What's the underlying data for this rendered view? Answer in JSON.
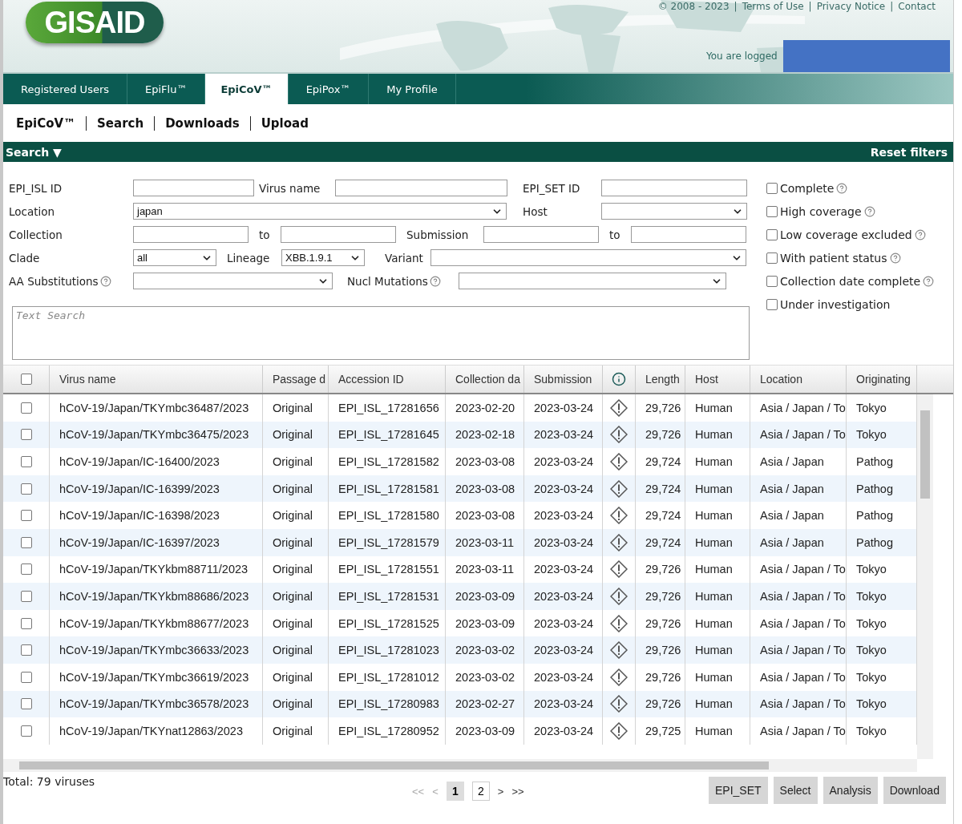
{
  "header": {
    "top_links": [
      "© 2008 - 2023",
      "|",
      "Terms of Use",
      "|",
      "Privacy Notice",
      "|",
      "Contact"
    ],
    "logo": "GISAID",
    "login_text": "You are logged"
  },
  "nav_tabs": [
    {
      "label": "Registered Users",
      "selected": false
    },
    {
      "label": "EpiFlu™",
      "selected": false
    },
    {
      "label": "EpiCoV™",
      "selected": true
    },
    {
      "label": "EpiPox™",
      "selected": false
    },
    {
      "label": "My Profile",
      "selected": false
    }
  ],
  "sub_nav": [
    "EpiCoV™",
    "Search",
    "Downloads",
    "Upload"
  ],
  "search_bar": {
    "title": "Search ▼",
    "reset": "Reset filters"
  },
  "filters": [
    [
      {
        "kind": "label",
        "text": "EPI_ISL ID"
      },
      {
        "kind": "input"
      },
      {
        "kind": "label",
        "text": "Virus name"
      },
      {
        "kind": "input"
      },
      {
        "kind": "label",
        "text": "EPI_SET ID"
      },
      {
        "kind": "input"
      }
    ],
    [
      {
        "kind": "label",
        "text": "Location"
      },
      {
        "kind": "select",
        "value": "japan"
      },
      {
        "kind": "label",
        "text": "Host"
      },
      {
        "kind": "select"
      }
    ],
    [
      {
        "kind": "label",
        "text": "Collection"
      },
      {
        "kind": "input"
      },
      {
        "kind": "label",
        "text": "to"
      },
      {
        "kind": "input"
      },
      {
        "kind": "label",
        "text": "Submission"
      },
      {
        "kind": "input"
      },
      {
        "kind": "label",
        "text": "to"
      },
      {
        "kind": "input"
      }
    ],
    [
      {
        "kind": "label",
        "text": "Clade"
      },
      {
        "kind": "select",
        "value": "all"
      },
      {
        "kind": "label",
        "text": "Lineage"
      },
      {
        "kind": "select",
        "value": "XBB.1.9.1"
      },
      {
        "kind": "label",
        "text": "Variant"
      },
      {
        "kind": "select"
      }
    ],
    [
      {
        "kind": "label",
        "text": "AA Substitutions",
        "help": true
      },
      {
        "kind": "select"
      },
      {
        "kind": "label",
        "text": "Nucl Mutations",
        "help": true
      },
      {
        "kind": "select"
      }
    ]
  ],
  "options": [
    {
      "label": "Complete",
      "checked": false,
      "help": true
    },
    {
      "label": "High coverage",
      "checked": false,
      "help": true
    },
    {
      "label": "Low coverage excluded",
      "checked": false,
      "help": true
    },
    {
      "label": "With patient status",
      "checked": false,
      "help": true
    },
    {
      "label": "Collection date complete",
      "checked": false,
      "help": true
    },
    {
      "label": "Under investigation",
      "checked": false,
      "help": false
    }
  ],
  "text_search": {
    "placeholder": "Text Search"
  },
  "table": {
    "header_checked": false,
    "columns": [
      {
        "kind": "text",
        "label": "Virus name"
      },
      {
        "kind": "text",
        "label": "Passage d"
      },
      {
        "kind": "text",
        "label": "Accession ID"
      },
      {
        "kind": "text",
        "label": "Collection da"
      },
      {
        "kind": "text",
        "label": "Submission"
      },
      {
        "kind": "info"
      },
      {
        "kind": "text",
        "label": "Length"
      },
      {
        "kind": "text",
        "label": "Host"
      },
      {
        "kind": "text",
        "label": "Location"
      },
      {
        "kind": "text",
        "label": "Originating"
      }
    ],
    "rows": [
      {
        "checked": false,
        "cells": [
          "hCoV-19/Japan/TKYmbc36487/2023",
          "Original",
          "EPI_ISL_17281656",
          "2023-02-20",
          "2023-03-24",
          "",
          "29,726",
          "Human",
          "Asia / Japan / To",
          "Tokyo"
        ]
      },
      {
        "checked": false,
        "cells": [
          "hCoV-19/Japan/TKYmbc36475/2023",
          "Original",
          "EPI_ISL_17281645",
          "2023-02-18",
          "2023-03-24",
          "",
          "29,726",
          "Human",
          "Asia / Japan / To",
          "Tokyo"
        ]
      },
      {
        "checked": false,
        "cells": [
          "hCoV-19/Japan/IC-16400/2023",
          "Original",
          "EPI_ISL_17281582",
          "2023-03-08",
          "2023-03-24",
          "",
          "29,724",
          "Human",
          "Asia / Japan",
          "Pathog"
        ]
      },
      {
        "checked": false,
        "cells": [
          "hCoV-19/Japan/IC-16399/2023",
          "Original",
          "EPI_ISL_17281581",
          "2023-03-08",
          "2023-03-24",
          "",
          "29,724",
          "Human",
          "Asia / Japan",
          "Pathog"
        ]
      },
      {
        "checked": false,
        "cells": [
          "hCoV-19/Japan/IC-16398/2023",
          "Original",
          "EPI_ISL_17281580",
          "2023-03-08",
          "2023-03-24",
          "",
          "29,724",
          "Human",
          "Asia / Japan",
          "Pathog"
        ]
      },
      {
        "checked": false,
        "cells": [
          "hCoV-19/Japan/IC-16397/2023",
          "Original",
          "EPI_ISL_17281579",
          "2023-03-11",
          "2023-03-24",
          "",
          "29,724",
          "Human",
          "Asia / Japan",
          "Pathog"
        ]
      },
      {
        "checked": false,
        "cells": [
          "hCoV-19/Japan/TKYkbm88711/2023",
          "Original",
          "EPI_ISL_17281551",
          "2023-03-11",
          "2023-03-24",
          "",
          "29,726",
          "Human",
          "Asia / Japan / To",
          "Tokyo"
        ]
      },
      {
        "checked": false,
        "cells": [
          "hCoV-19/Japan/TKYkbm88686/2023",
          "Original",
          "EPI_ISL_17281531",
          "2023-03-09",
          "2023-03-24",
          "",
          "29,726",
          "Human",
          "Asia / Japan / To",
          "Tokyo"
        ]
      },
      {
        "checked": false,
        "cells": [
          "hCoV-19/Japan/TKYkbm88677/2023",
          "Original",
          "EPI_ISL_17281525",
          "2023-03-09",
          "2023-03-24",
          "",
          "29,726",
          "Human",
          "Asia / Japan / To",
          "Tokyo"
        ]
      },
      {
        "checked": false,
        "cells": [
          "hCoV-19/Japan/TKYmbc36633/2023",
          "Original",
          "EPI_ISL_17281023",
          "2023-03-02",
          "2023-03-24",
          "",
          "29,726",
          "Human",
          "Asia / Japan / To",
          "Tokyo"
        ]
      },
      {
        "checked": false,
        "cells": [
          "hCoV-19/Japan/TKYmbc36619/2023",
          "Original",
          "EPI_ISL_17281012",
          "2023-03-02",
          "2023-03-24",
          "",
          "29,726",
          "Human",
          "Asia / Japan / To",
          "Tokyo"
        ]
      },
      {
        "checked": false,
        "cells": [
          "hCoV-19/Japan/TKYmbc36578/2023",
          "Original",
          "EPI_ISL_17280983",
          "2023-02-27",
          "2023-03-24",
          "",
          "29,726",
          "Human",
          "Asia / Japan / To",
          "Tokyo"
        ]
      },
      {
        "checked": false,
        "cells": [
          "hCoV-19/Japan/TKYnat12863/2023",
          "Original",
          "EPI_ISL_17280952",
          "2023-03-09",
          "2023-03-24",
          "",
          "29,725",
          "Human",
          "Asia / Japan / To",
          "Tokyo"
        ]
      }
    ]
  },
  "footer": {
    "total": "Total: 79 viruses",
    "nav_back": [
      "<<",
      "<"
    ],
    "pages": [
      {
        "label": "1",
        "selected": true
      },
      {
        "label": "2",
        "selected": false
      }
    ],
    "nav_forward": [
      ">",
      ">>"
    ],
    "buttons": [
      "EPI_SET",
      "Select",
      "Analysis",
      "Download"
    ]
  }
}
